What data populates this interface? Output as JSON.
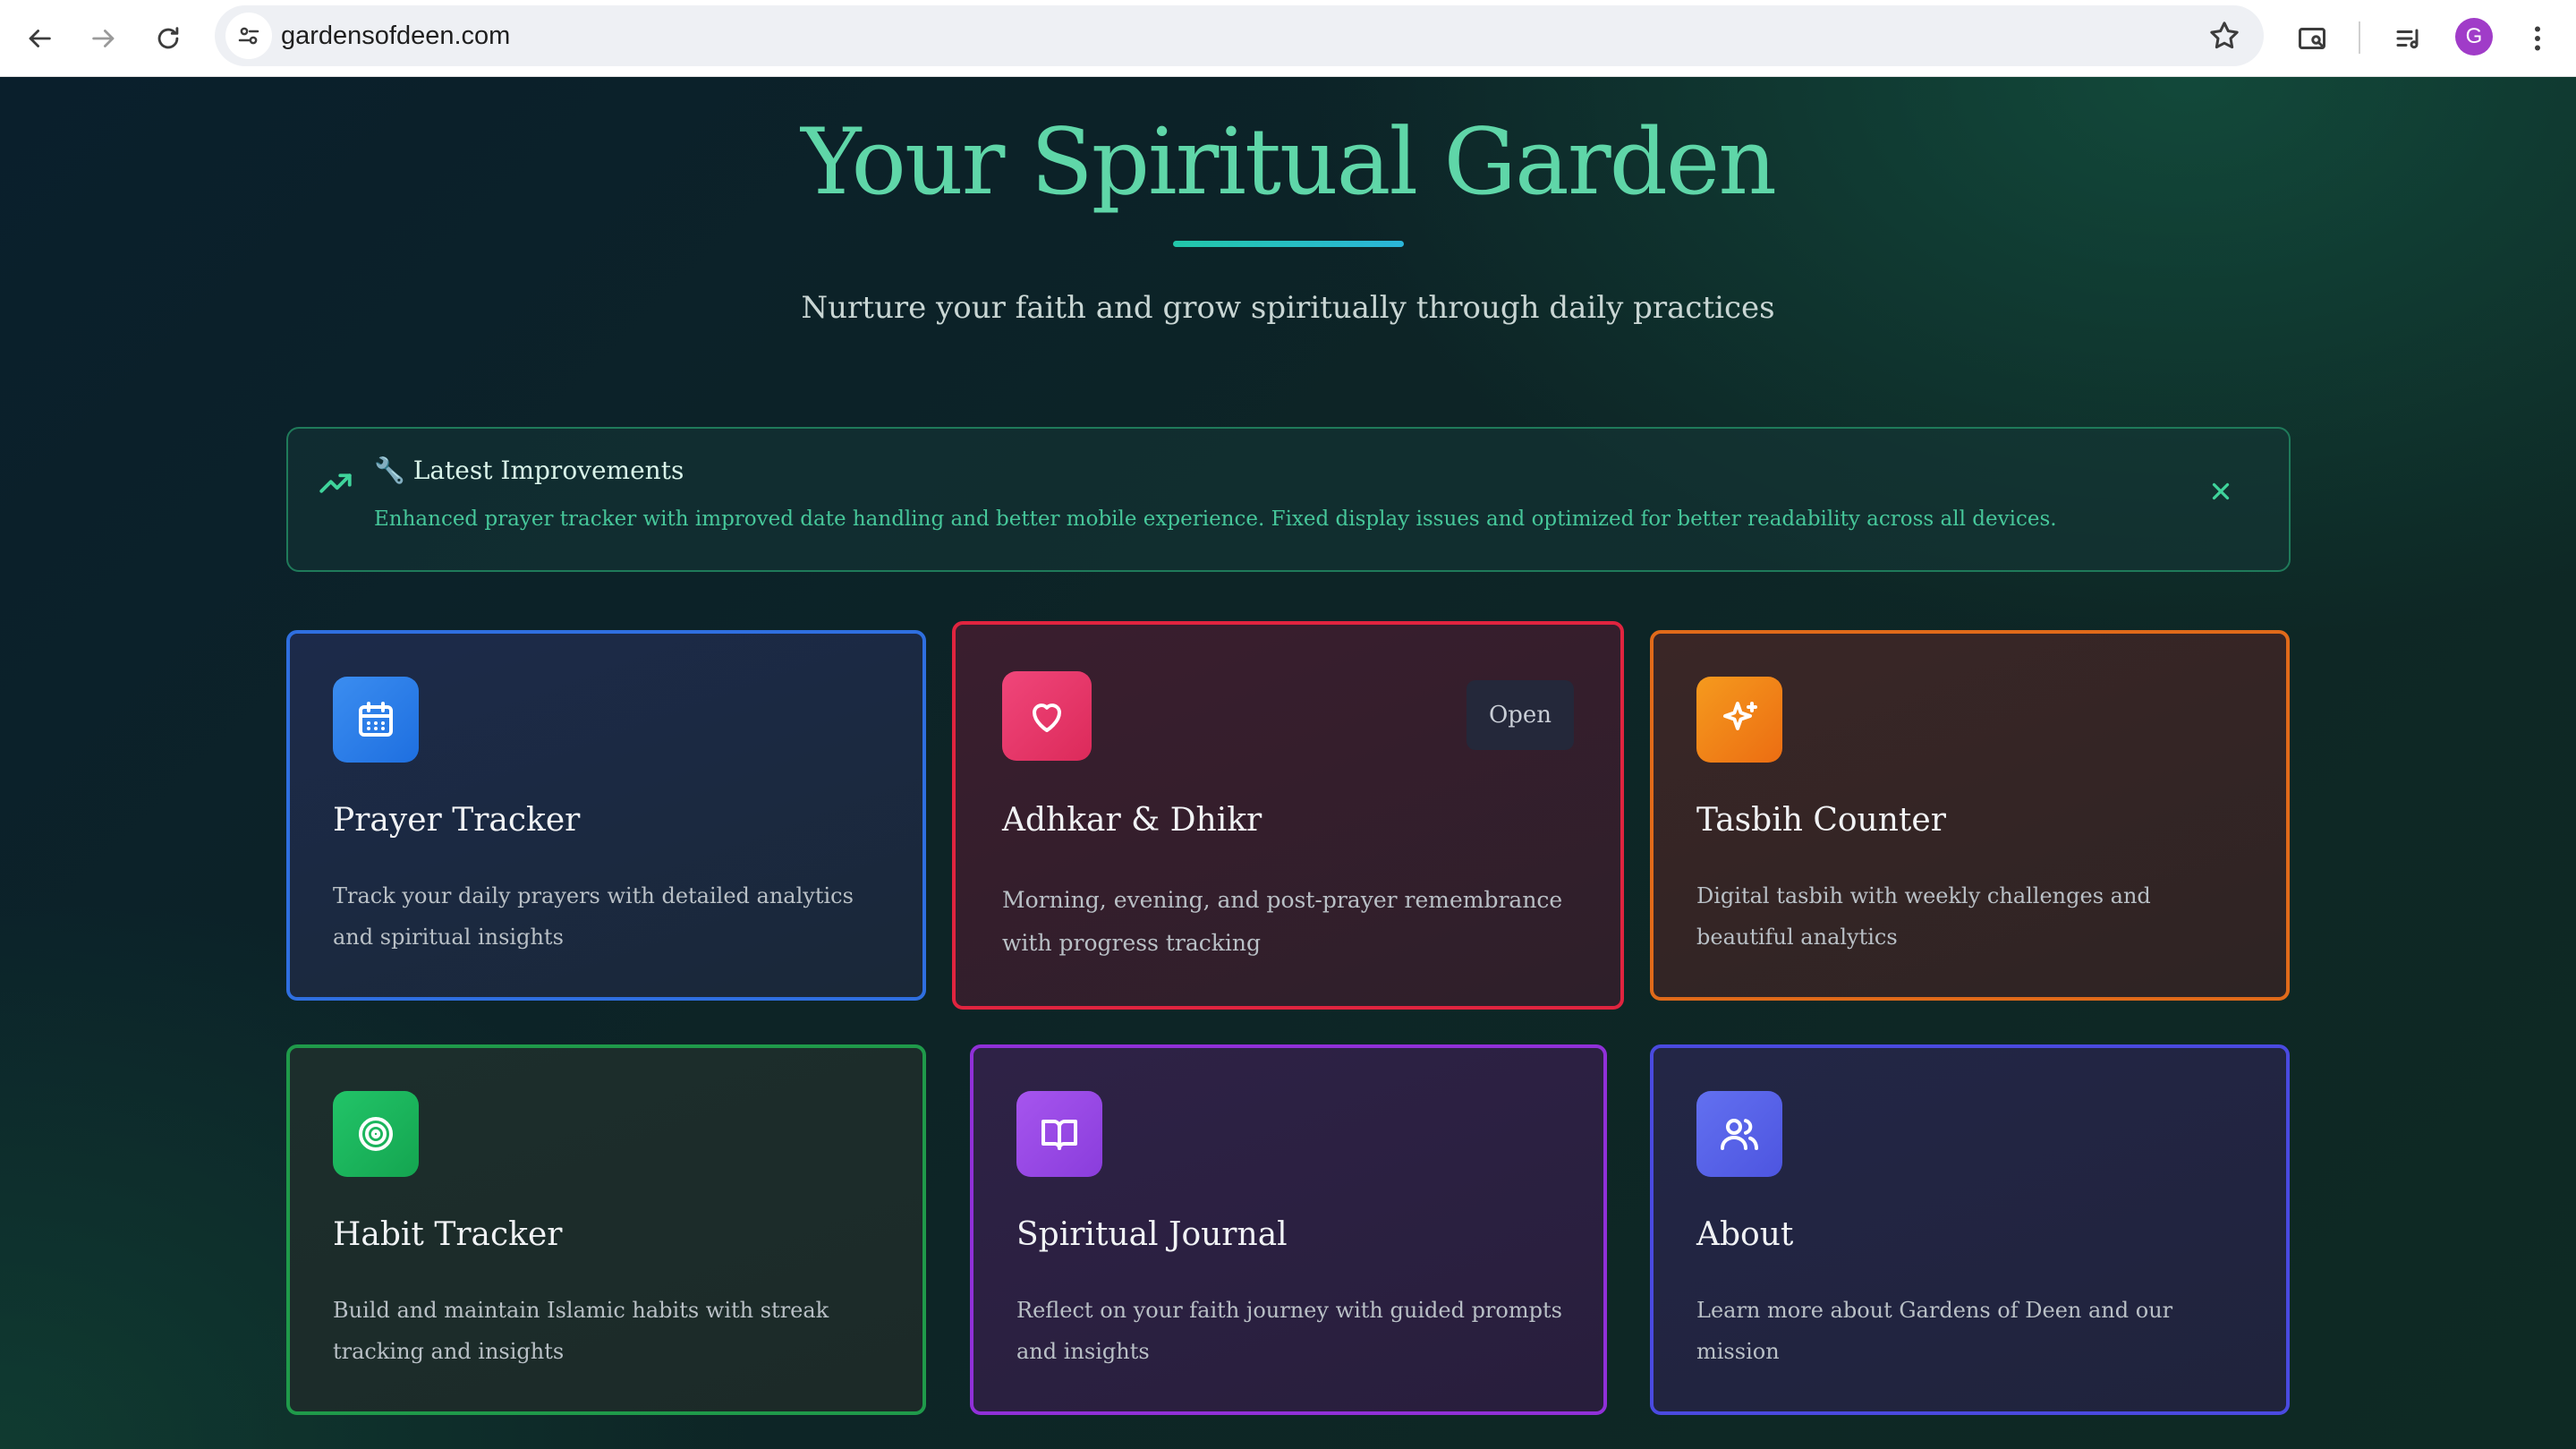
{
  "browser": {
    "url": "gardensofdeen.com",
    "profile_initial": "G"
  },
  "hero": {
    "title": "Your Spiritual Garden",
    "subtitle": "Nurture your faith and grow spiritually through daily practices"
  },
  "notice": {
    "title": "🔧 Latest Improvements",
    "text": "Enhanced prayer tracker with improved date handling and better mobile experience. Fixed display issues and optimized for better readability across all devices."
  },
  "cards": [
    {
      "title": "Prayer Tracker",
      "description": "Track your daily prayers with detailed analytics and spiritual insights",
      "icon": "calendar-icon",
      "color": "#2f7de1"
    },
    {
      "title": "Adhkar & Dhikr",
      "description": "Morning, evening, and post-prayer remembrance with progress tracking",
      "icon": "heart-icon",
      "color": "#e0335f",
      "action_label": "Open"
    },
    {
      "title": "Tasbih Counter",
      "description": "Digital tasbih with weekly challenges and beautiful analytics",
      "icon": "sparkles-icon",
      "color": "#ee7a1c"
    },
    {
      "title": "Habit Tracker",
      "description": "Build and maintain Islamic habits with streak tracking and insights",
      "icon": "target-icon",
      "color": "#1fb35a"
    },
    {
      "title": "Spiritual Journal",
      "description": "Reflect on your faith journey with guided prompts and insights",
      "icon": "book-open-icon",
      "color": "#9b4ce6"
    },
    {
      "title": "About",
      "description": "Learn more about Gardens of Deen and our mission",
      "icon": "users-icon",
      "color": "#5a63e6"
    }
  ]
}
